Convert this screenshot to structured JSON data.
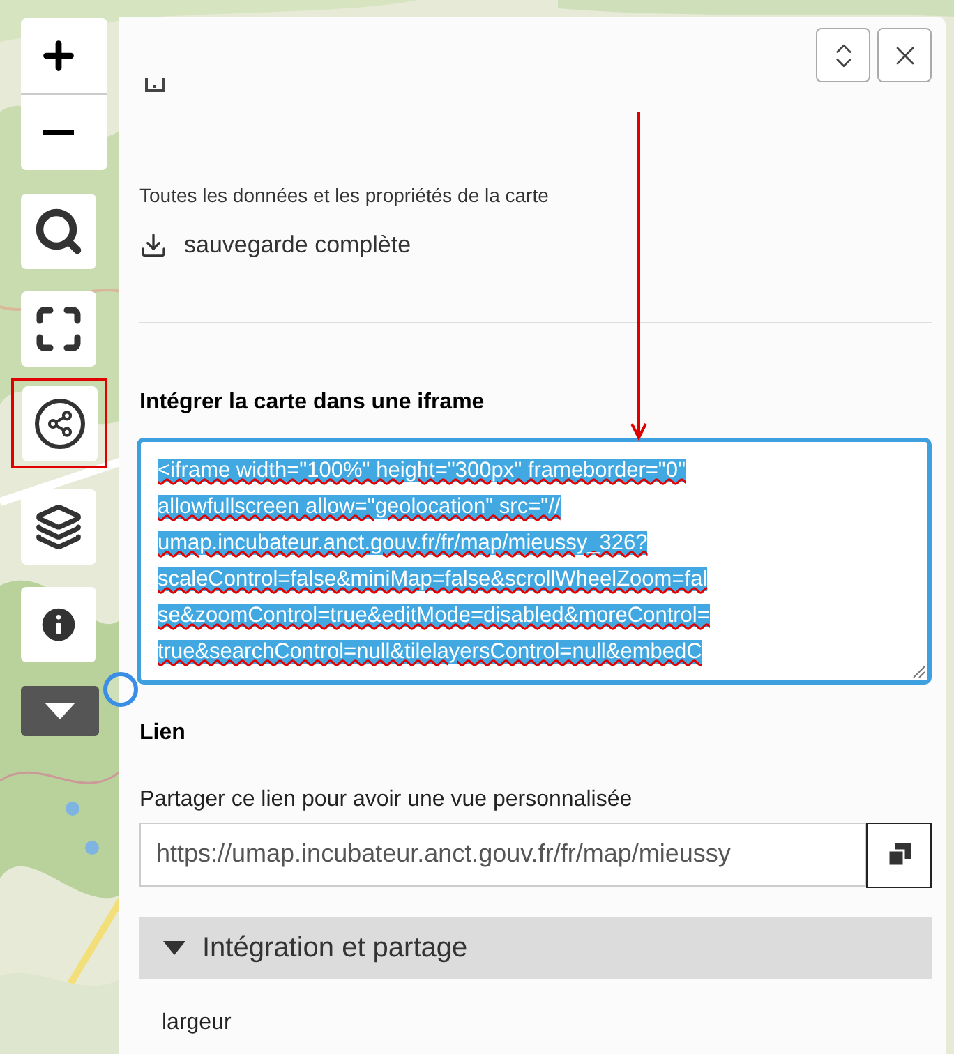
{
  "panel": {
    "export_description": "Toutes les données et les propriétés de la carte",
    "full_backup_link": "sauvegarde complète",
    "embed_heading": "Intégrer la carte dans une iframe",
    "embed_code_lines": [
      "<iframe width=\"100%\" height=\"300px\" frameborder=\"0\"",
      "allowfullscreen allow=\"geolocation\" src=\"//",
      "umap.incubateur.anct.gouv.fr/fr/map/mieussy_326?",
      "scaleControl=false&miniMap=false&scrollWheelZoom=fal",
      "se&zoomControl=true&editMode=disabled&moreControl=",
      "true&searchControl=null&tilelayersControl=null&embedC"
    ],
    "link_heading": "Lien",
    "link_description": "Partager ce lien pour avoir une vue personnalisée",
    "link_url": "https://umap.incubateur.anct.gouv.fr/fr/map/mieussy",
    "section": {
      "title": "Intégration et partage",
      "expanded": true
    },
    "width_label": "largeur"
  }
}
